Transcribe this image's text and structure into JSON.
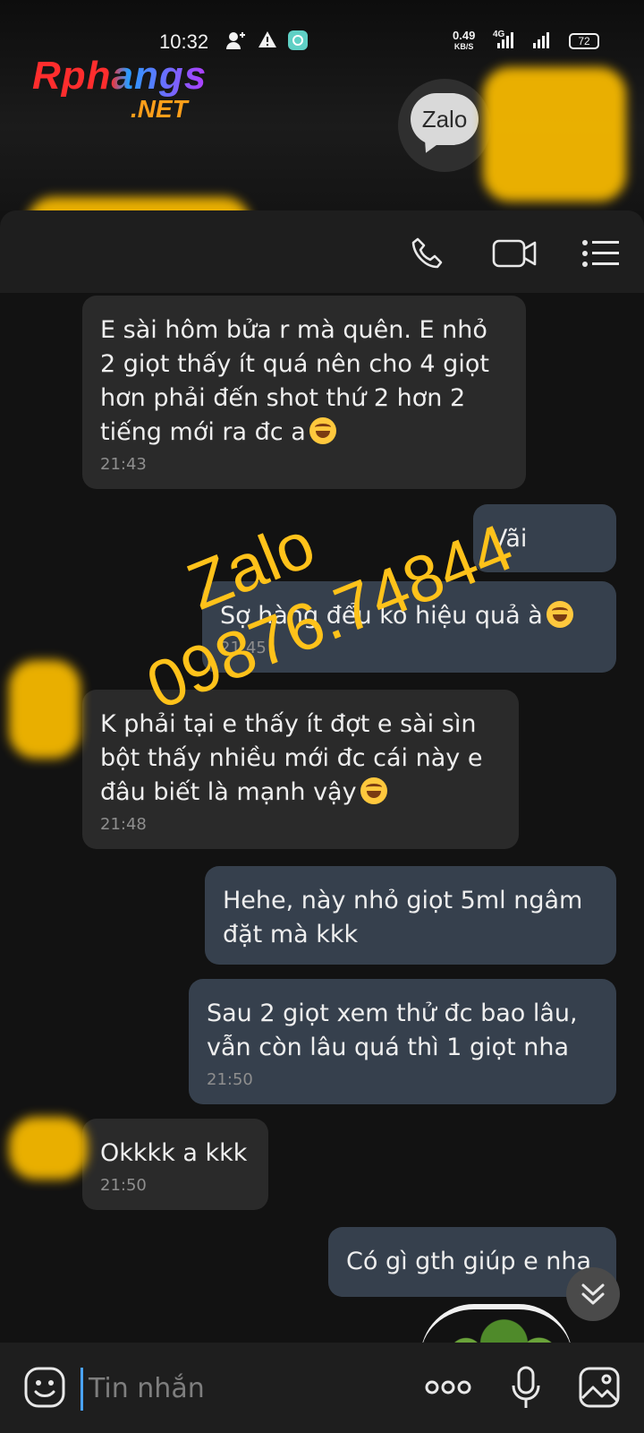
{
  "status_bar": {
    "time": "10:32",
    "net_speed": "0.49",
    "net_unit": "KB/S",
    "network_type": "4G",
    "battery": "72"
  },
  "watermark": {
    "brand": "Rphangs",
    "tld": ".NET",
    "zalo_line1": "Zalo",
    "zalo_line2": "09876.74844"
  },
  "app_logo": "Zalo",
  "messages": [
    {
      "side": "in",
      "text": "E sài hôm bửa r mà quên. E nhỏ 2 giọt thấy ít quá nên cho 4 giọt hơn phải đến shot thứ 2 hơn 2 tiếng mới ra đc a",
      "emoji": "rofl",
      "time": "21:43"
    },
    {
      "side": "out",
      "text": "Vãi",
      "time": ""
    },
    {
      "side": "out",
      "text": "Sợ hàng đểu ko hiệu quả à",
      "emoji": "joy",
      "time": "21:45"
    },
    {
      "side": "in",
      "text": "K phải tại e thấy ít đợt e sài sìn bột thấy nhiều mới đc cái này e đâu biết là mạnh vậy",
      "emoji": "rofl",
      "time": "21:48"
    },
    {
      "side": "out",
      "text": "Hehe, này nhỏ giọt 5ml ngâm đặt mà kkk",
      "time": ""
    },
    {
      "side": "out",
      "text": "Sau 2 giọt xem thử đc bao lâu, vẫn còn lâu quá thì 1 giọt nha",
      "time": "21:50"
    },
    {
      "side": "in",
      "text": "Okkkk a kkk",
      "time": "21:50"
    },
    {
      "side": "out",
      "text": "Có gì gth giúp e nha",
      "time": ""
    }
  ],
  "input": {
    "placeholder": "Tin nhắn"
  },
  "icons": [
    "phone-icon",
    "video-icon",
    "menu-icon",
    "emoji-icon",
    "more-icon",
    "mic-icon",
    "image-icon",
    "chevron-down-icon"
  ]
}
